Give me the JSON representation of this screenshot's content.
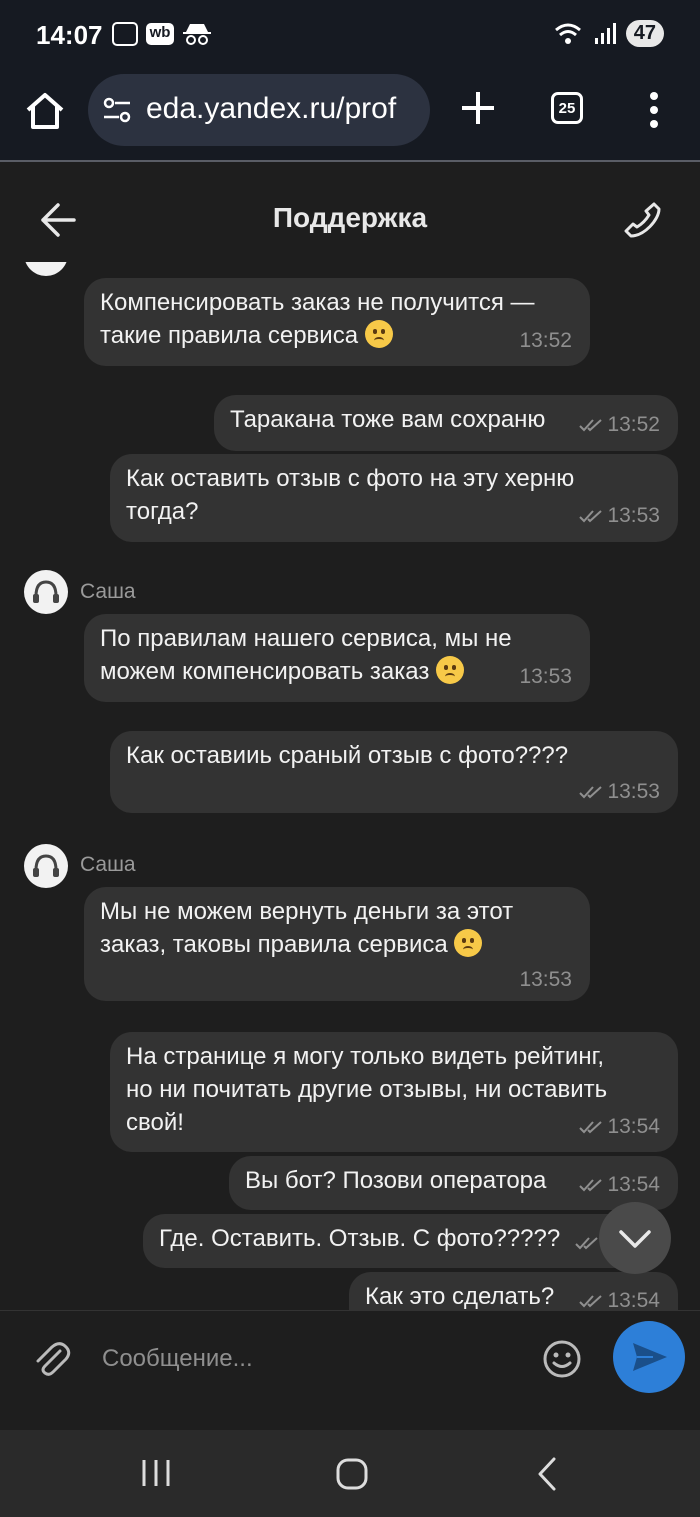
{
  "status_bar": {
    "time": "14:07",
    "wb_label": "wb",
    "battery": "47"
  },
  "browser": {
    "url": "eda.yandex.ru/prof",
    "tab_count": "25"
  },
  "header": {
    "title": "Поддержка"
  },
  "messages": [
    {
      "text1": "Компенсировать заказ не получится —",
      "text2": "такие правила сервиса",
      "time": "13:52"
    },
    {
      "text1": "Таракана тоже вам сохраню",
      "time": "13:52"
    },
    {
      "text1": "Как оставить отзыв с фото на эту херню",
      "text2": "тогда?",
      "time": "13:53"
    },
    {
      "sender": "Саша",
      "text1": "По правилам нашего сервиса, мы не",
      "text2": "можем компенсировать заказ",
      "time": "13:53"
    },
    {
      "text1": "Как оставииь сраный отзыв с фото????",
      "time": "13:53"
    },
    {
      "sender": "Саша",
      "text1": "Мы не можем вернуть деньги за этот",
      "text2": "заказ, таковы правила сервиса",
      "time": "13:53"
    },
    {
      "text1": "На странице я могу только видеть рейтинг,",
      "text2": "но ни почитать другие отзывы, ни оставить",
      "text3": "свой!",
      "time": "13:54"
    },
    {
      "text1": "Вы бот? Позови оператора",
      "time": "13:54"
    },
    {
      "text1": "Где. Оставить. Отзыв. С фото?????"
    },
    {
      "text1": "Как это сделать?",
      "time": "13:54"
    }
  ],
  "input": {
    "placeholder": "Сообщение..."
  },
  "icons": {
    "home": "home-icon",
    "tune": "site-settings-icon",
    "plus": "new-tab-icon",
    "menu": "more-vert-icon",
    "back": "arrow-back-icon",
    "call": "phone-icon",
    "attach": "paperclip-icon",
    "emoji": "smiley-icon",
    "send": "send-icon",
    "scroll": "chevron-down-icon",
    "read": "double-check-icon"
  },
  "colors": {
    "background": "#1e1e1e",
    "bubble": "#333333",
    "send_button": "#2d7fd8",
    "time_text": "#8f8f8f"
  }
}
